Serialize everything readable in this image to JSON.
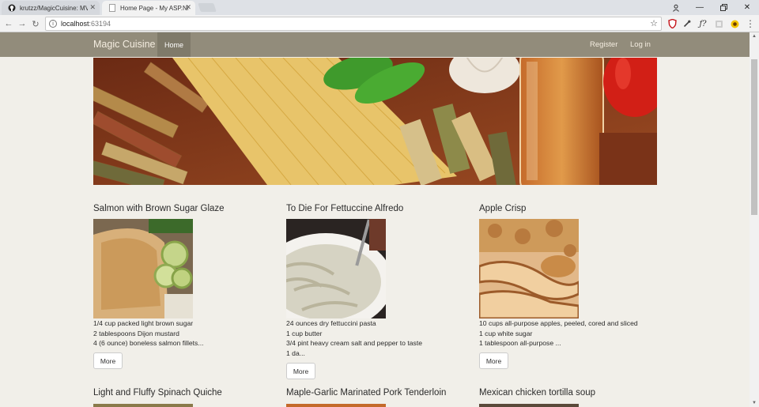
{
  "browser": {
    "tabs": [
      {
        "title": "krutzz/MagicCuisine: MV",
        "active": false
      },
      {
        "title": "Home Page - My ASP.NE",
        "active": true
      }
    ],
    "url_host": "localhost",
    "url_port": ":63194"
  },
  "site": {
    "brand": "Magic Cuisine",
    "nav": {
      "home": "Home",
      "register": "Register",
      "login": "Log in"
    }
  },
  "recipes": [
    {
      "title": "Salmon with Brown Sugar Glaze",
      "ingredients": [
        "1/4 cup packed light brown sugar",
        "2 tablespoons Dijon mustard",
        "4 (6 ounce) boneless salmon fillets..."
      ],
      "more": "More"
    },
    {
      "title": "To Die For Fettuccine Alfredo",
      "ingredients": [
        "24 ounces dry fettuccini pasta",
        "1 cup butter",
        "3/4 pint heavy cream salt and pepper to taste",
        "1 da..."
      ],
      "more": "More"
    },
    {
      "title": "Apple Crisp",
      "ingredients": [
        "10 cups all-purpose apples, peeled, cored and sliced",
        "1 cup white sugar",
        "1 tablespoon all-purpose ..."
      ],
      "more": "More"
    },
    {
      "title": "Light and Fluffy Spinach Quiche"
    },
    {
      "title": "Maple-Garlic Marinated Pork Tenderloin"
    },
    {
      "title": "Mexican chicken tortilla soup"
    }
  ]
}
